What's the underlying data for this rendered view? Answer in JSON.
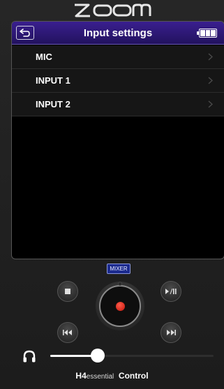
{
  "brand": {
    "logo_text": "ZOOM"
  },
  "header": {
    "title": "Input settings"
  },
  "menu": {
    "items": [
      {
        "label": "MIC"
      },
      {
        "label": "INPUT 1"
      },
      {
        "label": "INPUT 2"
      }
    ]
  },
  "transport": {
    "mixer_label": "MIXER"
  },
  "volume": {
    "level": 0.29
  },
  "footer": {
    "model": "H4",
    "model_suffix": "essential",
    "app": "Control"
  },
  "colors": {
    "titlebar": "#2c1878",
    "record": "#e02418",
    "mixer": "#1b2a8e",
    "background": "#1f1f1f"
  },
  "icons": {
    "back": "back-arrow-icon",
    "battery": "battery-icon",
    "stop": "stop-icon",
    "play_pause": "play-pause-icon",
    "rewind": "rewind-icon",
    "fast_forward": "fast-forward-icon",
    "record": "record-icon",
    "headphones": "headphones-icon"
  }
}
